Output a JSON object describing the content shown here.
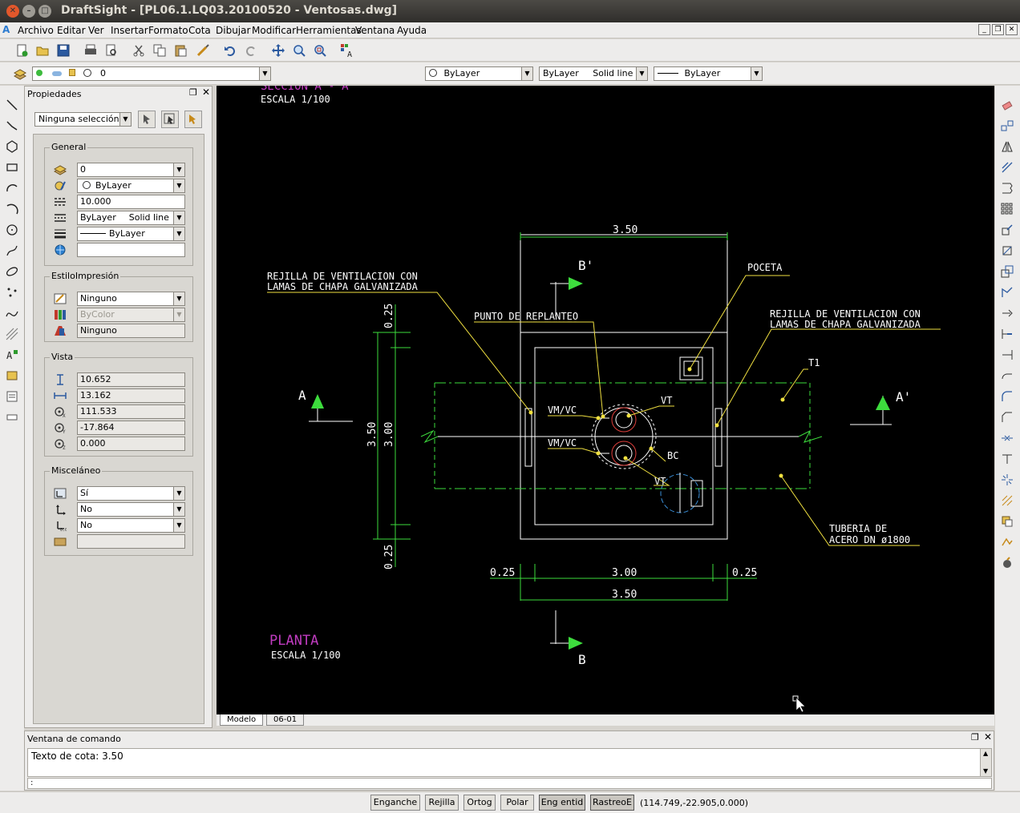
{
  "window": {
    "title": "DraftSight - [PL06.1.LQ03.20100520 - Ventosas.dwg]"
  },
  "menu": [
    "Archivo",
    "Editar",
    "Ver",
    "Insertar",
    "Formato",
    "Cota",
    "Dibujar",
    "Modificar",
    "Herramientas",
    "Ventana",
    "Ayuda"
  ],
  "layer_toolbar": {
    "layer_value": "0"
  },
  "props_toolbar": {
    "color": "ByLayer",
    "linestyle": "ByLayer",
    "linestyle_type": "Solid line",
    "lineweight": "ByLayer"
  },
  "properties": {
    "title": "Propiedades",
    "selection": "Ninguna selección",
    "general": {
      "title": "General",
      "layer": "0",
      "color": "ByLayer",
      "scale": "10.000",
      "linestyle": "ByLayer",
      "linestyle_type": "Solid line",
      "lineweight": "ByLayer",
      "hyperlink": ""
    },
    "print_style": {
      "title": "EstiloImpresión",
      "style": "Ninguno",
      "color": "ByColor",
      "table": "Ninguno"
    },
    "view": {
      "title": "Vista",
      "height": "10.652",
      "width": "13.162",
      "center_x": "111.533",
      "center_y": "-17.864",
      "center_z": "0.000"
    },
    "misc": {
      "title": "Misceláneo",
      "ucs_icon": "Sí",
      "ucs_origin": "No",
      "ucs_per_viewport": "No",
      "ucs_name": ""
    }
  },
  "drawing": {
    "section_title": "SECCION A - A",
    "scale_top": "ESCALA 1/100",
    "plan_title": "PLANTA",
    "plan_scale": "ESCALA 1/100",
    "dim_top": "3.50",
    "dim_bottom_total": "3.50",
    "dim_bottom_inner": "3.00",
    "dim_bottom_left": "0.25",
    "dim_bottom_right": "0.25",
    "dim_left_outer": "3.50",
    "dim_left_inner": "3.00",
    "dim_left_top": "0.25",
    "dim_left_bottom": "0.25",
    "label_rejilla_left_1": "REJILLA DE VENTILACION CON",
    "label_rejilla_left_2": "LAMAS DE CHAPA GALVANIZADA",
    "label_rejilla_right_1": "REJILLA DE VENTILACION CON",
    "label_rejilla_right_2": "LAMAS DE CHAPA GALVANIZADA",
    "label_punto": "PUNTO DE REPLANTEO",
    "label_poceta": "POCETA",
    "label_t1": "T1",
    "label_vt_top": "VT",
    "label_vt_bottom": "VT",
    "label_vmvc_1": "VM/VC",
    "label_vmvc_2": "VM/VC",
    "label_bc": "BC",
    "label_tuberia_1": "TUBERIA DE",
    "label_tuberia_2": "ACERO DN ø1800",
    "sec_a": "A",
    "sec_a2": "A'",
    "sec_b": "B",
    "sec_b2": "B'"
  },
  "tabs": [
    "Modelo",
    "06-01"
  ],
  "command": {
    "title": "Ventana de comando",
    "output": "Texto de cota: 3.50",
    "prompt": ":"
  },
  "status": {
    "snap": "Enganche",
    "grid": "Rejilla",
    "ortho": "Ortog",
    "polar": "Polar",
    "esnap": "Eng entid",
    "etrack": "RastreoE",
    "coords": "(114.749,-22.905,0.000)"
  }
}
